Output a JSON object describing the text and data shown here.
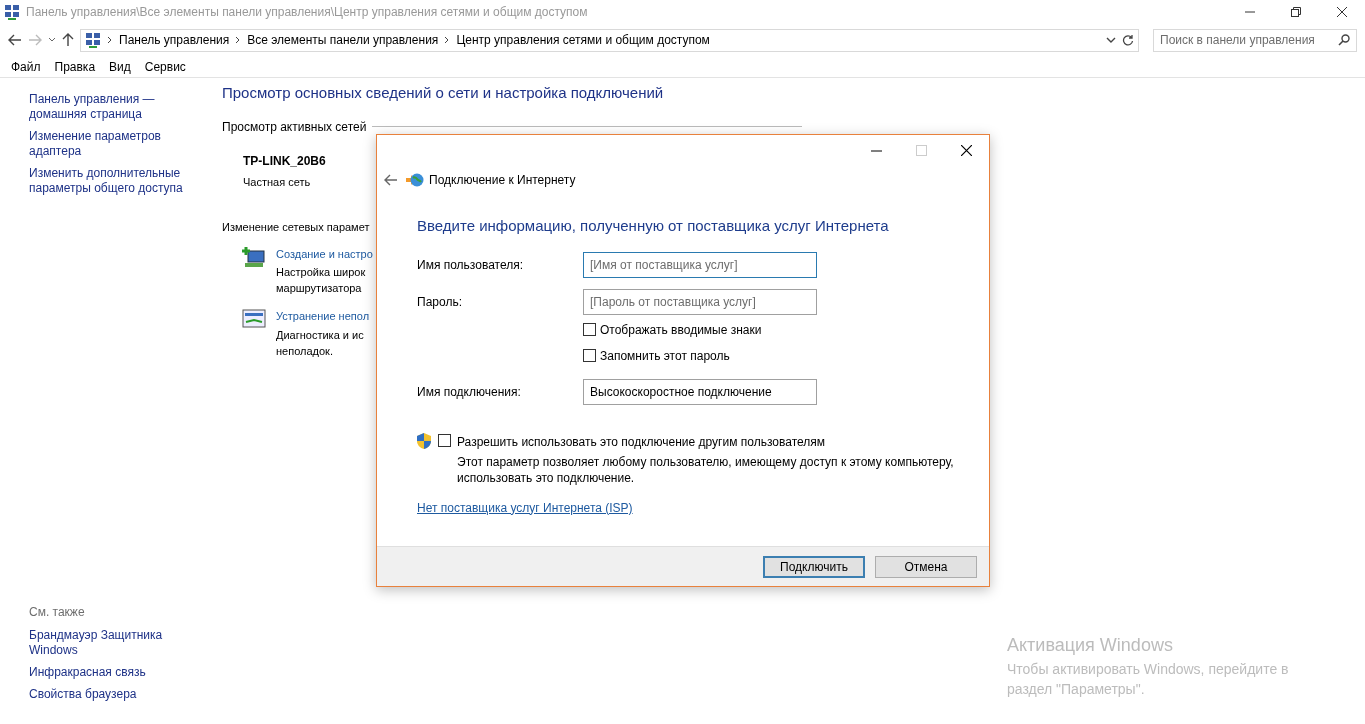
{
  "window": {
    "title": "Панель управления\\Все элементы панели управления\\Центр управления сетями и общим доступом"
  },
  "address_bar": {
    "breadcrumbs": [
      "Панель управления",
      "Все элементы панели управления",
      "Центр управления сетями и общим доступом"
    ],
    "search_placeholder": "Поиск в панели управления"
  },
  "menu": [
    "Файл",
    "Правка",
    "Вид",
    "Сервис"
  ],
  "sidebar": {
    "links": [
      "Панель управления — домашняя страница",
      "Изменение параметров адаптера",
      "Изменить дополнительные параметры общего доступа"
    ],
    "see_also_title": "См. также",
    "see_also": [
      "Брандмауэр Защитника Windows",
      "Инфракрасная связь",
      "Свойства браузера"
    ]
  },
  "main": {
    "heading": "Просмотр основных сведений о сети и настройка подключений",
    "active_networks_label": "Просмотр активных сетей",
    "network": {
      "name": "TP-LINK_20B6",
      "type": "Частная сеть"
    },
    "change_settings_label": "Изменение сетевых парамет",
    "tasks": [
      {
        "kind": "setup",
        "title": "Создание и настро",
        "description": [
          "Настройка широк",
          "маршрутизатора"
        ]
      },
      {
        "kind": "troubleshoot",
        "title": "Устранение непол",
        "description": [
          "Диагностика и ис",
          "неполадок."
        ]
      }
    ]
  },
  "dialog": {
    "title": "Подключение к Интернету",
    "heading": "Введите информацию, полученную от поставщика услуг Интернета",
    "fields": [
      {
        "label": "Имя пользователя:",
        "placeholder": "[Имя от поставщика услуг]",
        "focused": true
      },
      {
        "label": "Пароль:",
        "placeholder": "[Пароль от поставщика услуг]",
        "focused": false
      },
      {
        "label": "Имя подключения:",
        "value": "Высокоскоростное подключение",
        "focused": false
      }
    ],
    "checkboxes": [
      {
        "label": "Отображать вводимые знаки",
        "checked": false
      },
      {
        "label": "Запомнить этот пароль",
        "checked": false
      }
    ],
    "share": {
      "label": "Разрешить использовать это подключение другим пользователям",
      "checked": false,
      "description": "Этот параметр позволяет любому пользователю, имеющему доступ к этому компьютеру, использовать это подключение."
    },
    "link": "Нет поставщика услуг Интернета (ISP)",
    "buttons": [
      {
        "label": "Подключить",
        "default": true
      },
      {
        "label": "Отмена",
        "default": false
      }
    ]
  },
  "activation": {
    "title": "Активация Windows",
    "text": "Чтобы активировать Windows, перейдите в раздел \"Параметры\"."
  }
}
